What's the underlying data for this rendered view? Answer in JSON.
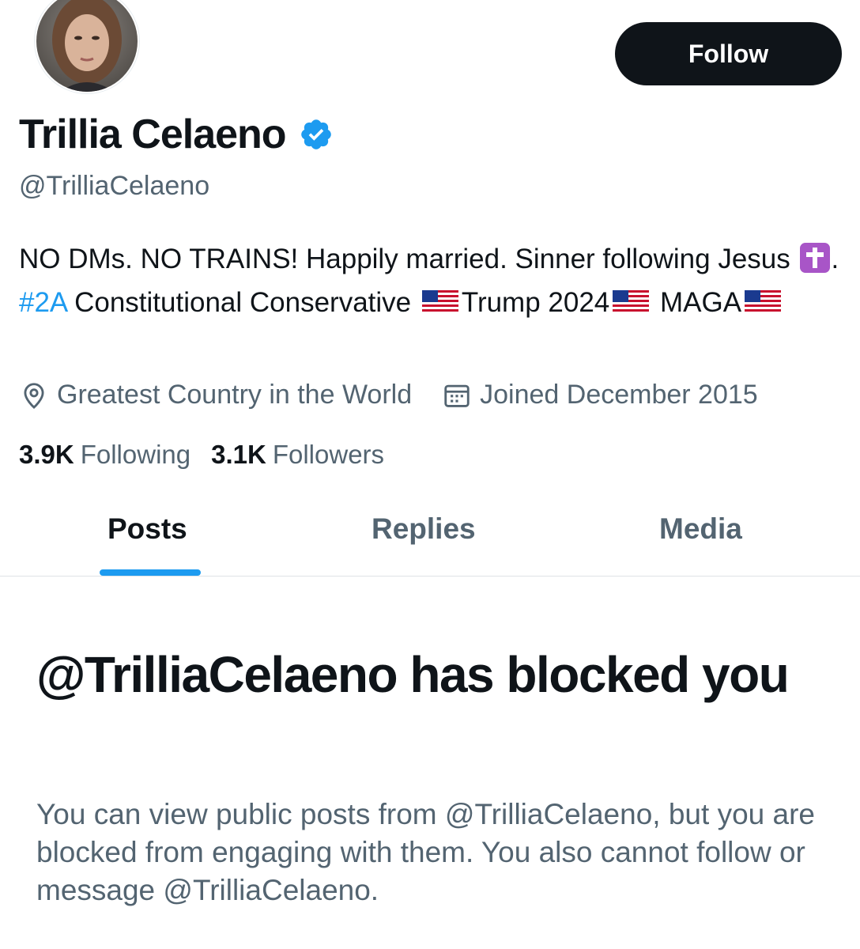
{
  "profile": {
    "display_name": "Trillia Celaeno",
    "handle": "@TrilliaCelaeno",
    "verified": true,
    "verified_color": "#1d9bf0",
    "avatar_icon": "profile-photo"
  },
  "actions": {
    "follow_label": "Follow"
  },
  "bio": {
    "part1": "NO DMs. NO TRAINS! Happily married. Sinner following Jesus ",
    "cross_emoji": "latin-cross-emoji",
    "part2": ". ",
    "hashtag": "#2A",
    "part3": " Constitutional Conservative ",
    "part4": "Trump 2024",
    "part5": " MAGA",
    "flag_emoji": "us-flag-emoji"
  },
  "meta": {
    "location_icon": "location-pin-icon",
    "location": "Greatest Country in the World",
    "joined_icon": "calendar-icon",
    "joined": "Joined December 2015"
  },
  "stats": {
    "following_count": "3.9K",
    "following_label": "Following",
    "followers_count": "3.1K",
    "followers_label": "Followers"
  },
  "tabs": [
    {
      "label": "Posts",
      "active": true
    },
    {
      "label": "Replies",
      "active": false
    },
    {
      "label": "Media",
      "active": false
    }
  ],
  "blocked": {
    "title": "@TrilliaCelaeno has blocked you",
    "description": "You can view public posts from @TrilliaCelaeno, but you are blocked from engaging with them. You also cannot follow or message @TrilliaCelaeno."
  },
  "colors": {
    "text_primary": "#0f1419",
    "text_secondary": "#536471",
    "accent": "#1d9bf0",
    "button_bg": "#0f1419"
  }
}
